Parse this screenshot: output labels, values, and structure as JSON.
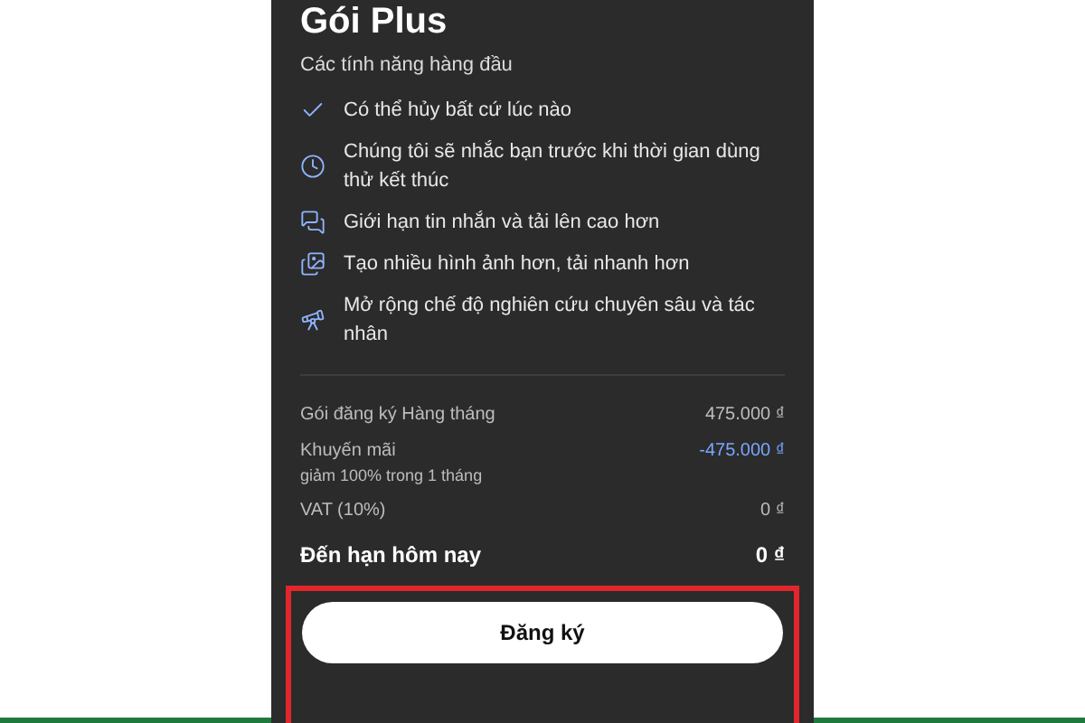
{
  "title": "Gói Plus",
  "features_heading": "Các tính năng hàng đầu",
  "features": [
    {
      "kind": "check",
      "text": "Có thể hủy bất cứ lúc nào"
    },
    {
      "kind": "clock",
      "text": "Chúng tôi sẽ nhắc bạn trước khi thời gian dùng thử kết thúc"
    },
    {
      "kind": "chat",
      "text": "Giới hạn tin nhắn và tải lên cao hơn"
    },
    {
      "kind": "images",
      "text": "Tạo nhiều hình ảnh hơn, tải nhanh hơn"
    },
    {
      "kind": "research",
      "text": "Mở rộng chế độ nghiên cứu chuyên sâu và tác nhân"
    }
  ],
  "price_rows": [
    {
      "kind": "normal",
      "label": "Gói đăng ký Hàng tháng",
      "amount": "475.000 ₫"
    },
    {
      "kind": "discount",
      "label": "Khuyến mãi",
      "note": "giảm 100% trong 1 tháng",
      "amount": "-475.000 ₫"
    },
    {
      "kind": "normal",
      "label": "VAT (10%)",
      "amount": "0 ₫"
    }
  ],
  "total": {
    "label": "Đến hạn hôm nay",
    "amount": "0 ₫"
  },
  "subscribe_button": {
    "label": "Đăng ký",
    "highlighted": true
  }
}
